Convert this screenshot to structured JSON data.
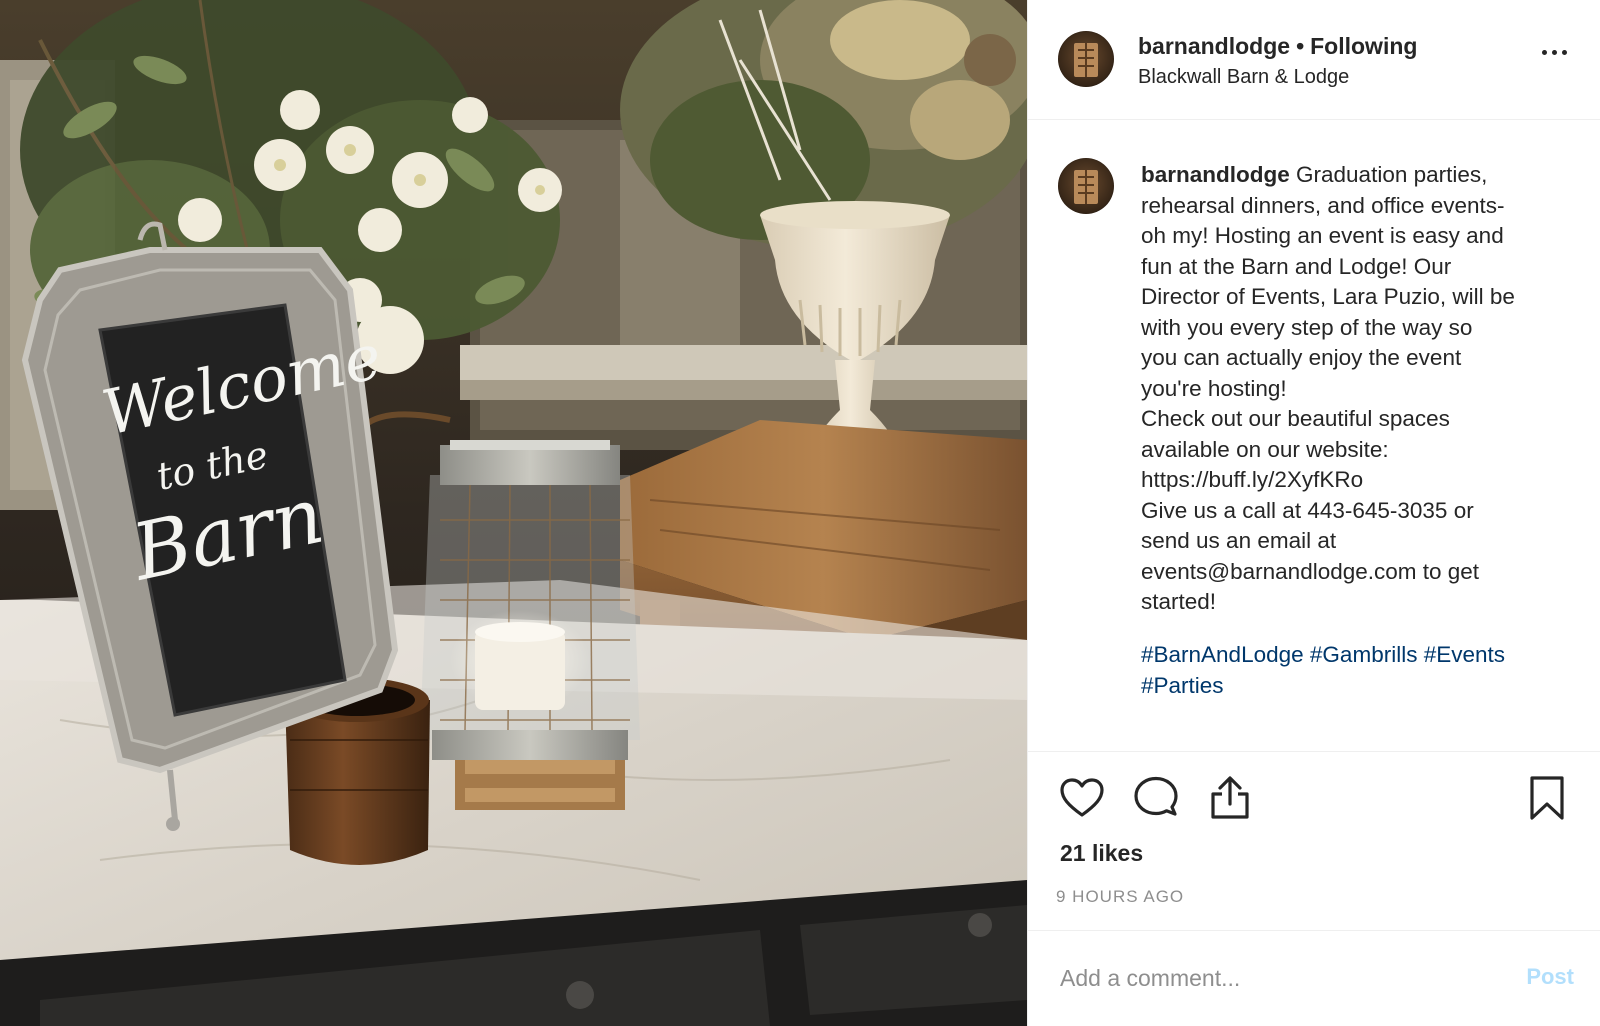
{
  "post": {
    "username": "barnandlodge",
    "dot": "•",
    "follow_status": "Following",
    "location": "Blackwall Barn & Lodge",
    "caption_user": "barnandlodge",
    "caption_text": " Graduation parties,\nrehearsal dinners, and office events-\noh my! Hosting an event is easy and\nfun at the Barn and Lodge! Our\nDirector of Events, Lara Puzio, will be\nwith you every step of the way so\nyou can actually enjoy the event\nyou're hosting!\nCheck out our beautiful spaces\navailable on our website:\nhttps://buff.ly/2XyfKRo\nGive us a call at 443-645-3035 or\nsend us an email at\nevents@barnandlodge.com to get\nstarted!",
    "hashtags": [
      "#BarnAndLodge",
      "#Gambrills",
      "#Events",
      "#Parties"
    ],
    "likes": "21 likes",
    "time_ago": "9 HOURS AGO"
  },
  "photo": {
    "sign_line1": "Welcome",
    "sign_line2": "to the",
    "sign_line3": "Barn"
  },
  "icons": {
    "more": "more-options-icon",
    "like": "heart-icon",
    "comment": "comment-icon",
    "share": "share-icon",
    "save": "bookmark-icon"
  },
  "comment": {
    "placeholder": "Add a comment...",
    "post_label": "Post"
  },
  "colors": {
    "text": "#262626",
    "hashtag": "#00376b",
    "muted": "#8e8e8e",
    "post_disabled": "#b2dffc",
    "border": "#efefef"
  }
}
